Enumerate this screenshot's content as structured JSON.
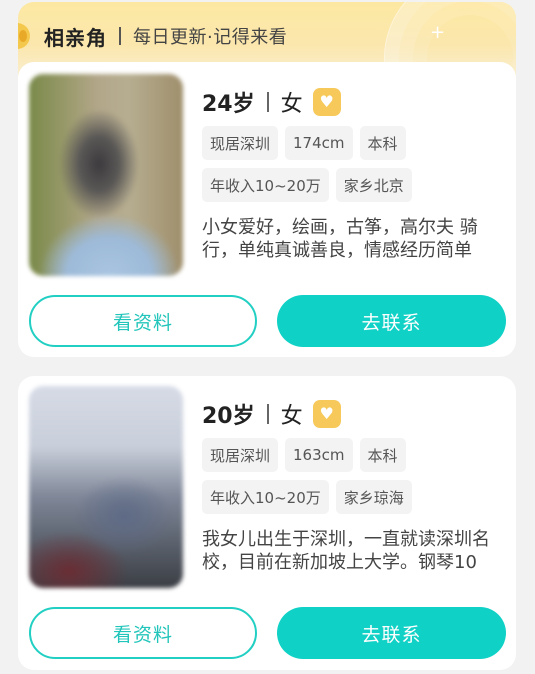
{
  "banner": {
    "title": "相亲角",
    "subtitle": "每日更新·记得来看",
    "sparkle": "+"
  },
  "profiles": [
    {
      "age": "24岁",
      "gender": "女",
      "badge_symbol": "♥",
      "tags": [
        "现居深圳",
        "174cm",
        "本科",
        "年收入10~20万",
        "家乡北京"
      ],
      "description": "小女爱好，绘画，古筝，高尔夫 骑行，单纯真诚善良，情感经历简单",
      "view_label": "看资料",
      "contact_label": "去联系"
    },
    {
      "age": "20岁",
      "gender": "女",
      "badge_symbol": "♥",
      "tags": [
        "现居深圳",
        "163cm",
        "本科",
        "年收入10~20万",
        "家乡琼海"
      ],
      "description": "我女儿出生于深圳，一直就读深圳名校，目前在新加坡上大学。钢琴10",
      "view_label": "看资料",
      "contact_label": "去联系"
    }
  ],
  "colors": {
    "accent": "#10d1c6",
    "badge": "#f6c95a",
    "banner_bg": "#fde8a2"
  }
}
